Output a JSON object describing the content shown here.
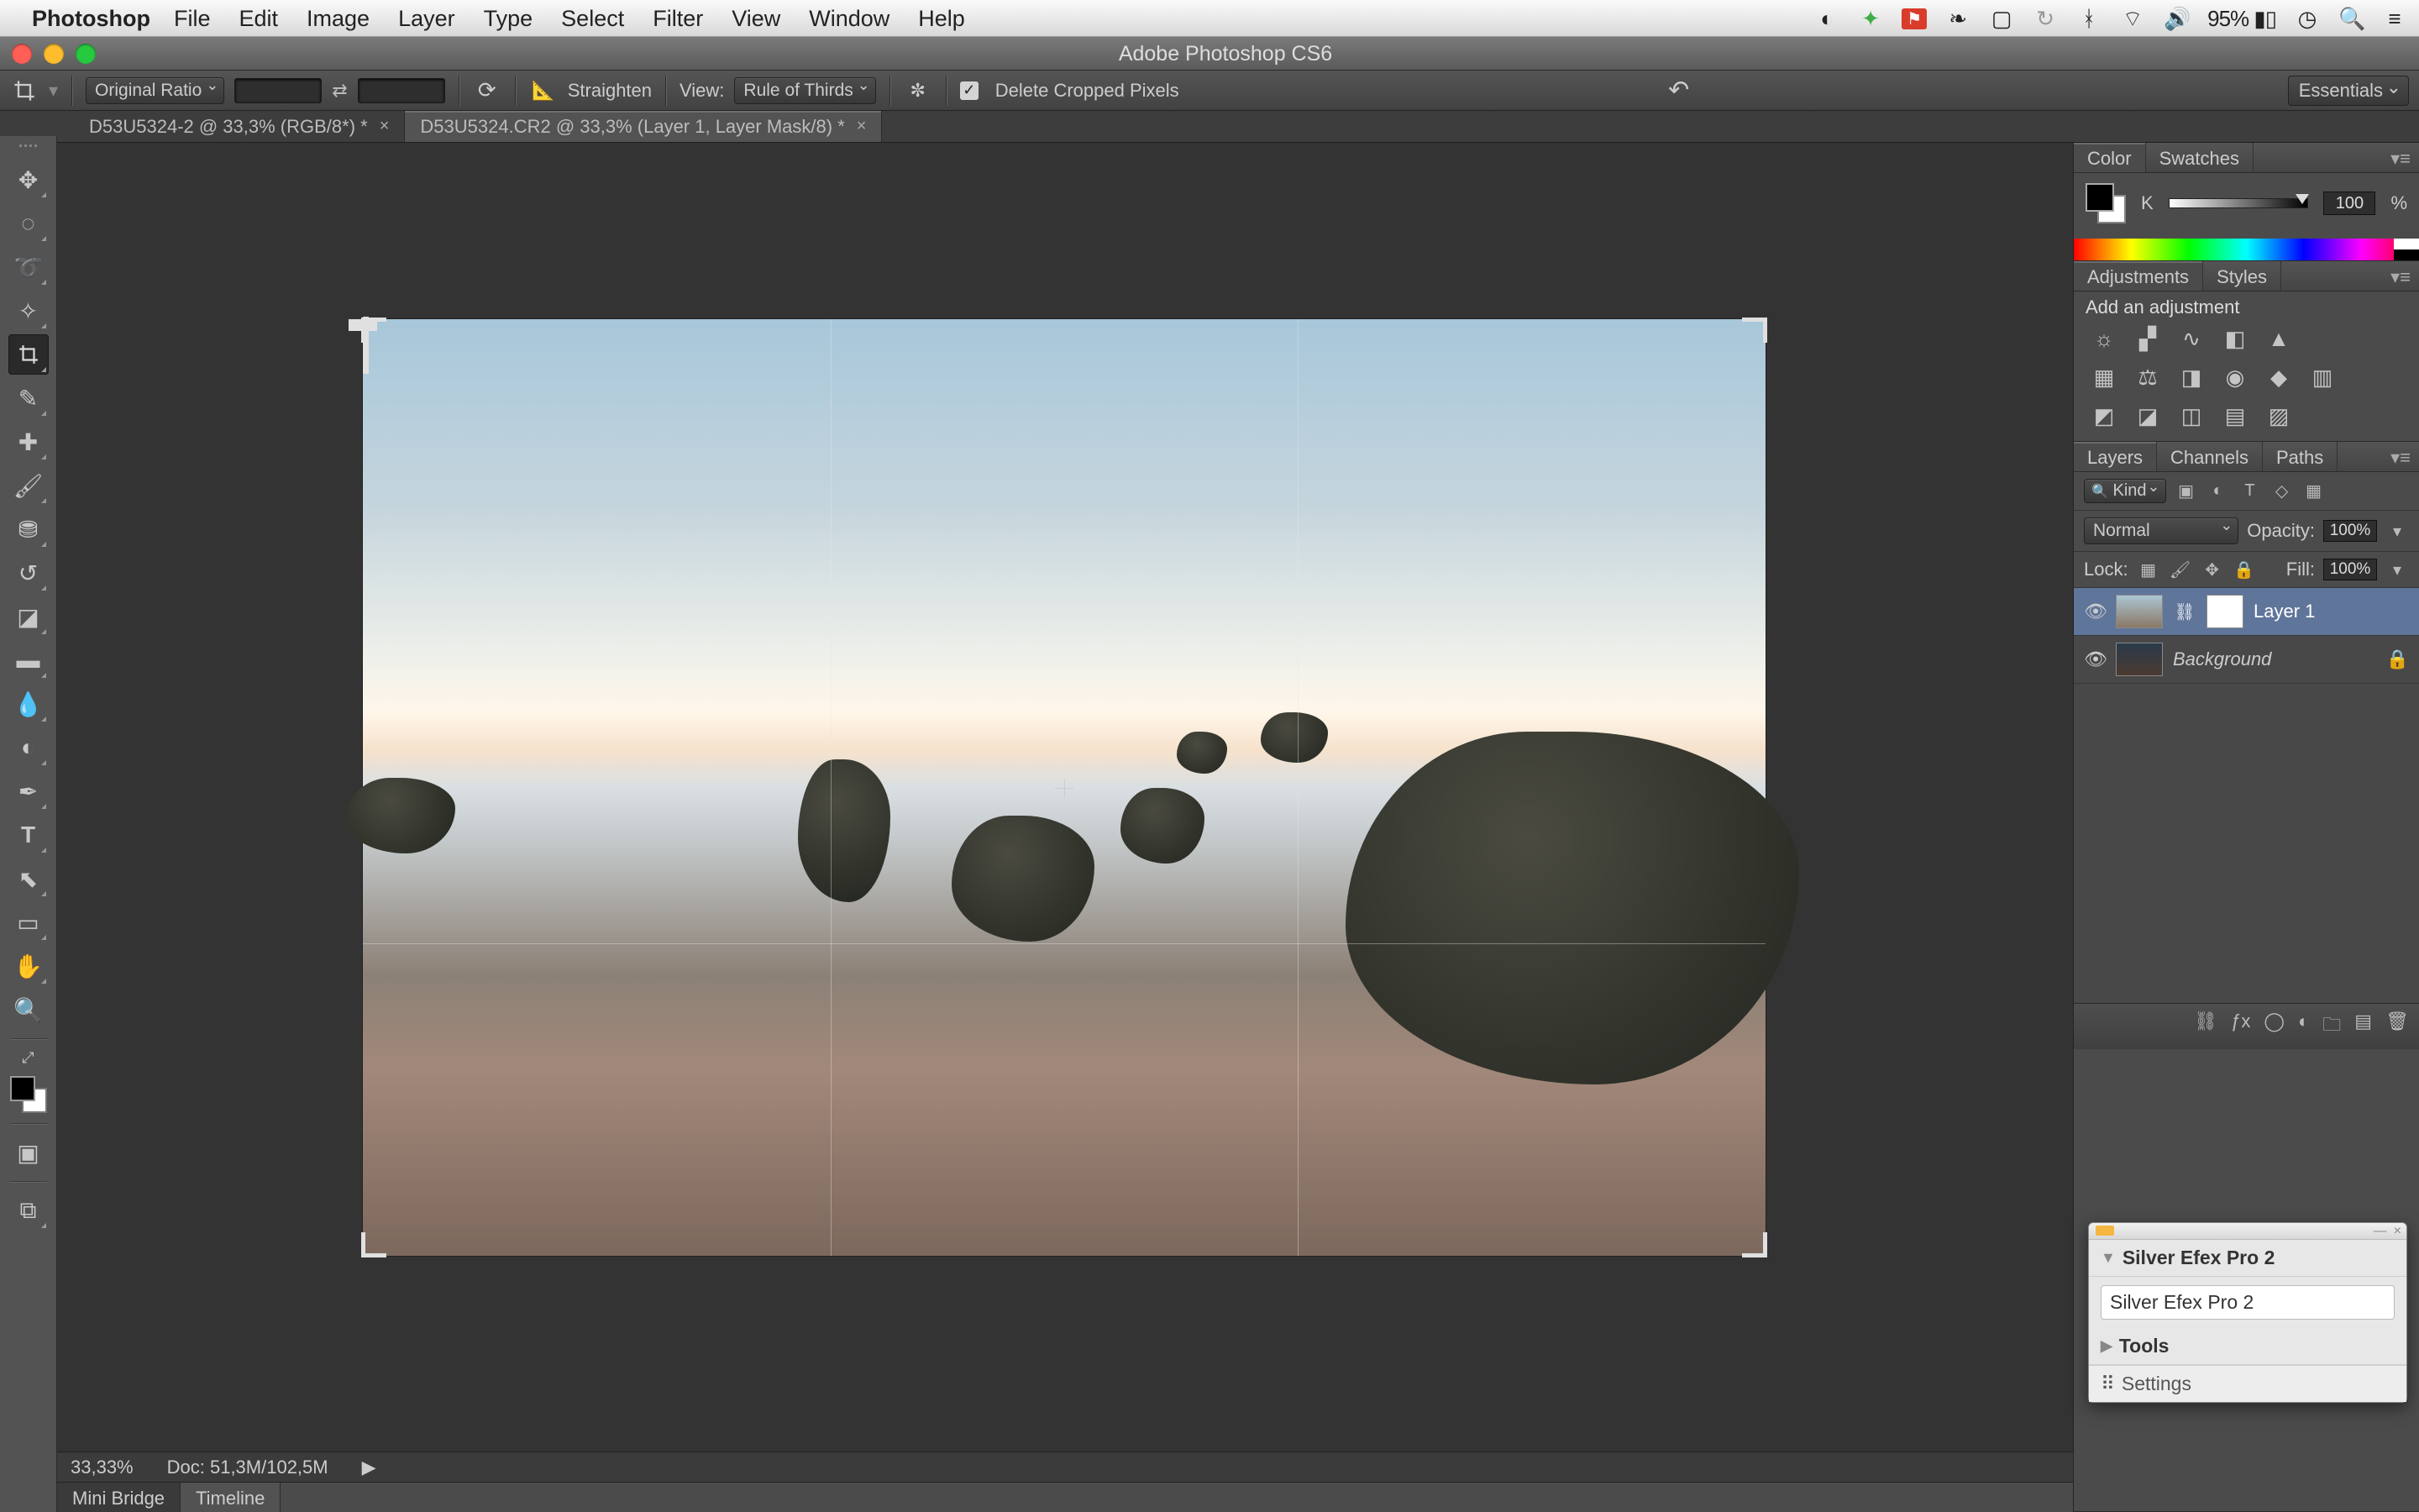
{
  "mac_menu": {
    "app": "Photoshop",
    "items": [
      "File",
      "Edit",
      "Image",
      "Layer",
      "Type",
      "Select",
      "Filter",
      "View",
      "Window",
      "Help"
    ],
    "battery_pct": "95%"
  },
  "window": {
    "title": "Adobe Photoshop CS6"
  },
  "options_bar": {
    "ratio_preset": "Original Ratio",
    "width": "",
    "height": "",
    "straighten": "Straighten",
    "view_label": "View:",
    "overlay": "Rule of Thirds",
    "delete_cropped": "Delete Cropped Pixels",
    "delete_cropped_checked": true,
    "workspace": "Essentials"
  },
  "doc_tabs": [
    {
      "label": "D53U5324-2 @ 33,3% (RGB/8*) *",
      "active": false
    },
    {
      "label": "D53U5324.CR2 @ 33,3% (Layer 1, Layer Mask/8) *",
      "active": true
    }
  ],
  "tools": [
    "move",
    "rect-marquee",
    "lasso",
    "magic-wand",
    "crop",
    "eyedropper",
    "healing",
    "brush",
    "clone",
    "history-brush",
    "eraser",
    "gradient",
    "blur",
    "dodge",
    "pen",
    "type",
    "path-select",
    "rectangle",
    "hand",
    "zoom"
  ],
  "status": {
    "zoom": "33,33%",
    "doc": "Doc: 51,3M/102,5M"
  },
  "bottom_tabs": [
    "Mini Bridge",
    "Timeline"
  ],
  "panels": {
    "color": {
      "tabs": [
        "Color",
        "Swatches"
      ],
      "k_label": "K",
      "k_value": "100",
      "pct": "%"
    },
    "adjustments": {
      "tabs": [
        "Adjustments",
        "Styles"
      ],
      "heading": "Add an adjustment"
    },
    "layers": {
      "tabs": [
        "Layers",
        "Channels",
        "Paths"
      ],
      "filter": "Kind",
      "blend": "Normal",
      "opacity_label": "Opacity:",
      "opacity": "100%",
      "lock_label": "Lock:",
      "fill_label": "Fill:",
      "fill": "100%",
      "items": [
        {
          "name": "Layer 1",
          "mask": true,
          "selected": true,
          "locked": false,
          "italic": false
        },
        {
          "name": "Background",
          "mask": false,
          "selected": false,
          "locked": true,
          "italic": true
        }
      ]
    }
  },
  "float": {
    "title": "Silver Efex Pro 2",
    "input": "Silver Efex Pro 2",
    "tools": "Tools",
    "settings": "Settings"
  }
}
